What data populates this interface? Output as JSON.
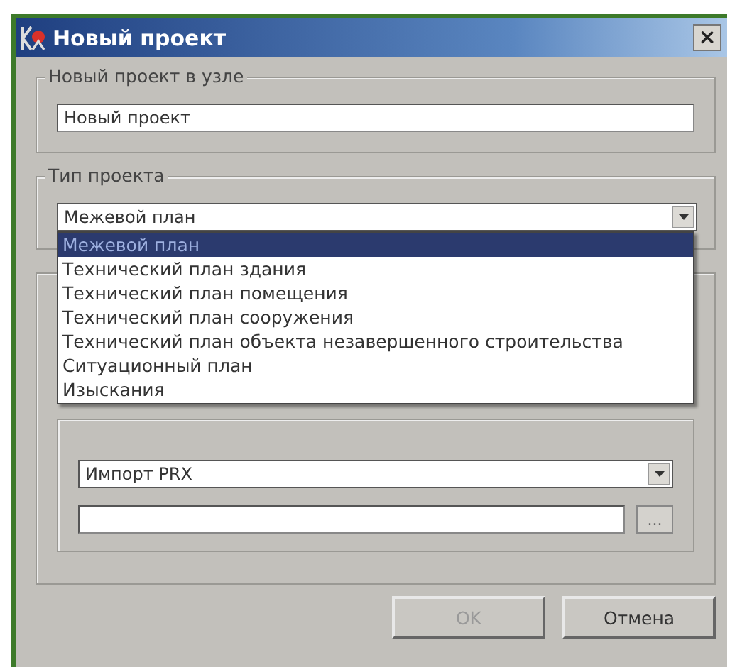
{
  "window": {
    "title": "Новый проект",
    "close": "×"
  },
  "node_group": {
    "title": "Новый проект в узле",
    "name_field": {
      "value": "Новый проект"
    }
  },
  "type_group": {
    "title": "Тип проекта",
    "combo": {
      "value": "Межевой план",
      "expanded": true
    },
    "options": [
      {
        "label": "Межевой план",
        "selected": true
      },
      {
        "label": "Технический план здания",
        "selected": false
      },
      {
        "label": "Технический план помещения",
        "selected": false
      },
      {
        "label": "Технический план сооружения",
        "selected": false
      },
      {
        "label": "Технический план объекта незавершенного строительства",
        "selected": false
      },
      {
        "label": "Ситуационный план",
        "selected": false
      },
      {
        "label": "Изыскания",
        "selected": false
      }
    ]
  },
  "import_group": {
    "import_combo": {
      "value": "Импорт PRX"
    },
    "browse_button": "..."
  },
  "buttons": [
    {
      "label": "OK",
      "disabled": true
    },
    {
      "label": "Отмена",
      "disabled": false
    }
  ]
}
